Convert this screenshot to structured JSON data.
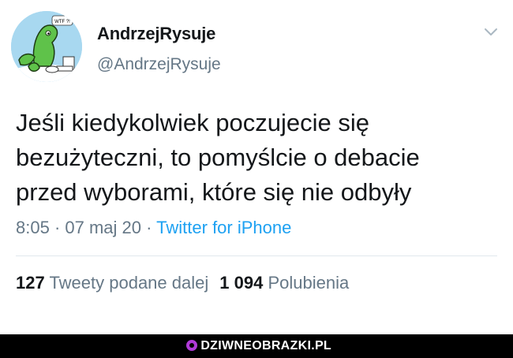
{
  "tweet": {
    "display_name": "AndrzejRysuje",
    "handle": "@AndrzejRysuje",
    "text_lines": [
      "Jeśli kiedykolwiek poczujecie się",
      "bezużyteczni, to pomyślcie o debacie",
      "przed wyborami, które się nie odbyły"
    ],
    "time": "8:05",
    "separator": " · ",
    "date": "07 maj 20",
    "source": "Twitter for iPhone",
    "retweets_count": "127",
    "retweets_label": "Tweety podane dalej",
    "likes_count": "1 094",
    "likes_label": "Polubienia",
    "avatar_badge": "WTF ?!",
    "more_icon": "chevron-down-icon"
  },
  "footer": {
    "brand": "DZIWNEOBRAZKI.PL"
  },
  "colors": {
    "text": "#14171a",
    "secondary": "#657786",
    "link": "#1da1f2",
    "avatar_bg": "#a8d8f0"
  }
}
